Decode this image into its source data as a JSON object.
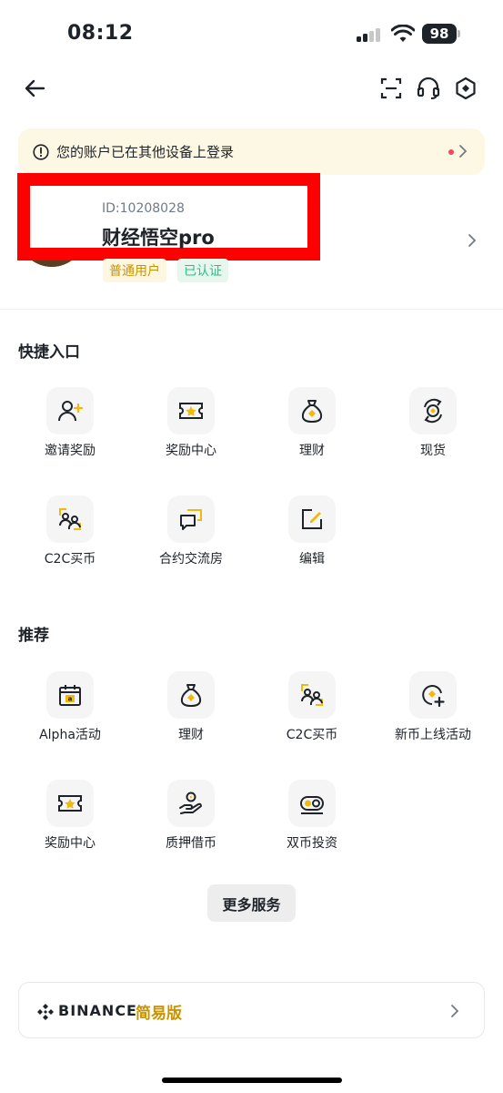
{
  "status_bar": {
    "time": "08:12",
    "battery": "98"
  },
  "notice": {
    "text": "您的账户已在其他设备上登录"
  },
  "profile": {
    "uid": "ID:10208028",
    "username": "财经悟空pro",
    "badges": [
      "普通用户",
      "已认证"
    ]
  },
  "quick_access": {
    "title": "快捷入口",
    "items": [
      {
        "label": "邀请奖励",
        "icon": "invite-user-icon"
      },
      {
        "label": "奖励中心",
        "icon": "reward-ticket-icon"
      },
      {
        "label": "理财",
        "icon": "money-bag-icon"
      },
      {
        "label": "现货",
        "icon": "spot-trade-icon"
      },
      {
        "label": "C2C买币",
        "icon": "c2c-users-icon"
      },
      {
        "label": "合约交流房",
        "icon": "chat-bubbles-icon"
      },
      {
        "label": "编辑",
        "icon": "edit-icon"
      }
    ]
  },
  "recommended": {
    "title": "推荐",
    "items": [
      {
        "label": "Alpha活动",
        "icon": "alpha-calendar-icon"
      },
      {
        "label": "理财",
        "icon": "money-bag-icon"
      },
      {
        "label": "C2C买币",
        "icon": "c2c-users-icon"
      },
      {
        "label": "新币上线活动",
        "icon": "new-coin-icon"
      },
      {
        "label": "奖励中心",
        "icon": "reward-ticket-icon"
      },
      {
        "label": "质押借币",
        "icon": "loan-hand-icon"
      },
      {
        "label": "双币投资",
        "icon": "dual-coin-icon"
      }
    ]
  },
  "more_button": "更多服务",
  "lite": {
    "brand": "BINANCE",
    "label": "简易版"
  },
  "colors": {
    "accent": "#F0B90B",
    "text": "#1E2329",
    "verified": "#2EBD85",
    "alert": "#F6465D"
  }
}
